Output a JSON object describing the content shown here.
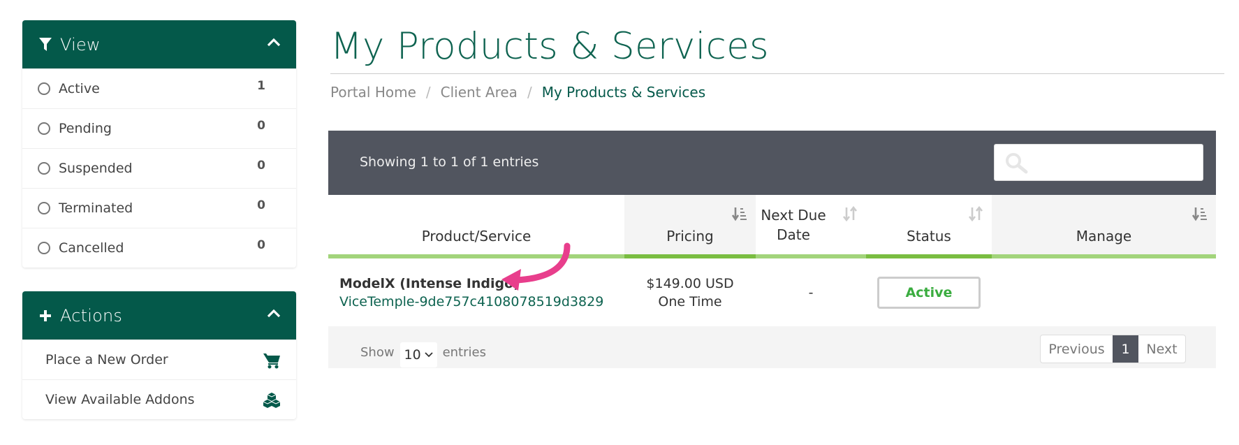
{
  "sidebar": {
    "view": {
      "title": "View",
      "icon": "filter-icon",
      "items": [
        {
          "label": "Active",
          "count": "1"
        },
        {
          "label": "Pending",
          "count": "0"
        },
        {
          "label": "Suspended",
          "count": "0"
        },
        {
          "label": "Terminated",
          "count": "0"
        },
        {
          "label": "Cancelled",
          "count": "0"
        }
      ]
    },
    "actions": {
      "title": "Actions",
      "icon": "plus-icon",
      "items": [
        {
          "label": "Place a New Order",
          "icon": "shopping-cart-icon"
        },
        {
          "label": "View Available Addons",
          "icon": "cubes-icon"
        }
      ]
    }
  },
  "page": {
    "title": "My Products & Services",
    "breadcrumb": [
      "Portal Home",
      "Client Area",
      "My Products & Services"
    ],
    "breadcrumb_separator": "/"
  },
  "table": {
    "info": "Showing 1 to 1 of 1 entries",
    "search": {
      "placeholder": "",
      "value": ""
    },
    "columns": [
      "Product/Service",
      "Pricing",
      "Next Due Date",
      "Status",
      "Manage"
    ],
    "rows": [
      {
        "product": "ModelX (Intense Indigo)",
        "domain": "ViceTemple-9de757c4108078519d3829",
        "price": "$149.00 USD",
        "cycle": "One Time",
        "next_due": "-",
        "status": "Active"
      }
    ],
    "footer": {
      "show_label": "Show",
      "page_size": "10",
      "entries_label": "entries",
      "previous": "Previous",
      "current_page": "1",
      "next": "Next"
    }
  },
  "colors": {
    "brand": "#04594a",
    "table_bar": "#51555f",
    "sort_line": "#a2d47b",
    "sort_line_active": "#7abd41",
    "status_active": "#3aac3f",
    "annotation_arrow": "#e83e8c"
  }
}
